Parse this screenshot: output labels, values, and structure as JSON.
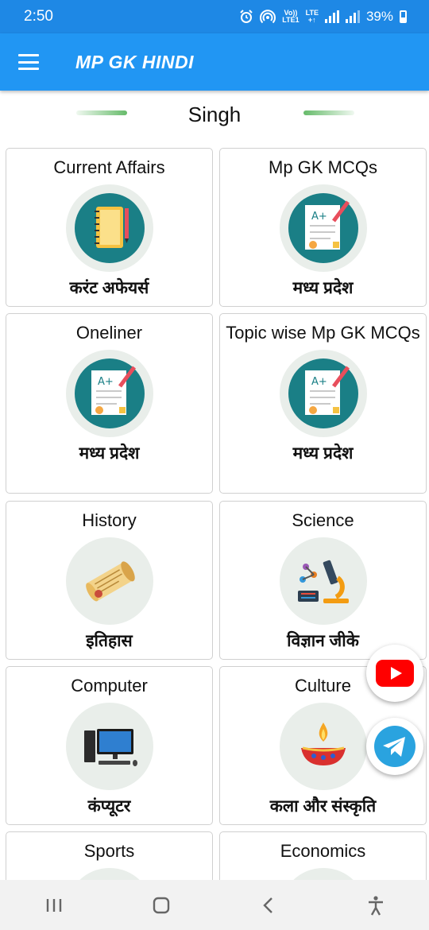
{
  "status_bar": {
    "time": "2:50",
    "network_top": "Vo))",
    "network_bottom": "LTE1",
    "lte_top": "LTE",
    "lte_bottom": "+↑",
    "battery": "39%"
  },
  "app_bar": {
    "title": "MP GK HINDI"
  },
  "section": {
    "title": "Singh"
  },
  "cards": [
    {
      "title": "Current Affairs",
      "subtitle": "करंट अफेयर्स",
      "icon": "notebook-icon"
    },
    {
      "title": "Mp GK MCQs",
      "subtitle": "मध्य प्रदेश",
      "icon": "test-paper-icon"
    },
    {
      "title": "Oneliner",
      "subtitle": "मध्य प्रदेश",
      "icon": "test-paper-icon"
    },
    {
      "title": "Topic wise Mp GK MCQs",
      "subtitle": "मध्य प्रदेश",
      "icon": "test-paper-icon"
    },
    {
      "title": "History",
      "subtitle": "इतिहास",
      "icon": "scroll-icon"
    },
    {
      "title": "Science",
      "subtitle": "विज्ञान जीके",
      "icon": "microscope-icon"
    },
    {
      "title": "Computer",
      "subtitle": "कंप्यूटर",
      "icon": "computer-icon"
    },
    {
      "title": "Culture",
      "subtitle": "कला और संस्कृति",
      "icon": "diya-lamp-icon"
    },
    {
      "title": "Sports",
      "subtitle": "",
      "icon": "sports-icon"
    },
    {
      "title": "Economics",
      "subtitle": "",
      "icon": "economics-icon"
    }
  ],
  "colors": {
    "status_bar": "#1e88e5",
    "app_bar": "#2196f3",
    "accent_line": "#66bb6a",
    "icon_bg": "#e9eeea"
  }
}
